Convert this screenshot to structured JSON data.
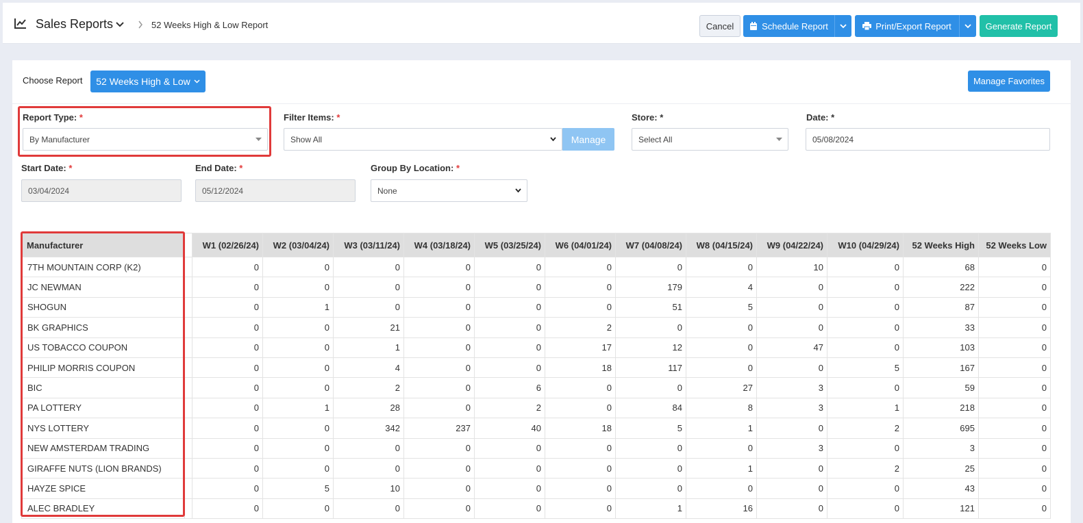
{
  "header": {
    "title": "Sales Reports",
    "current_page": "52 Weeks High & Low Report",
    "cancel_label": "Cancel",
    "schedule_label": "Schedule Report",
    "print_label": "Print/Export Report",
    "generate_label": "Generate Report"
  },
  "toolbar": {
    "choose_label": "Choose Report",
    "choose_value": "52 Weeks High & Low",
    "favorites_label": "Manage Favorites"
  },
  "form": {
    "report_type": {
      "label": "Report Type:",
      "required": "*",
      "value": "By Manufacturer"
    },
    "filter_items": {
      "label": "Filter Items:",
      "required": "*",
      "value": "Show All",
      "manage_label": "Manage"
    },
    "store": {
      "label": "Store:",
      "required": "*",
      "value": "Select All"
    },
    "date": {
      "label": "Date:",
      "required": "*",
      "value": "05/08/2024"
    },
    "start_date": {
      "label": "Start Date:",
      "required": "*",
      "value": "03/04/2024"
    },
    "end_date": {
      "label": "End Date:",
      "required": "*",
      "value": "05/12/2024"
    },
    "group_by": {
      "label": "Group By Location:",
      "required": "*",
      "value": "None"
    }
  },
  "table": {
    "columns": [
      "Manufacturer",
      "W1 (02/26/24)",
      "W2 (03/04/24)",
      "W3 (03/11/24)",
      "W4 (03/18/24)",
      "W5 (03/25/24)",
      "W6 (04/01/24)",
      "W7 (04/08/24)",
      "W8 (04/15/24)",
      "W9 (04/22/24)",
      "W10 (04/29/24)",
      "52 Weeks High",
      "52 Weeks Low"
    ],
    "rows": [
      [
        "7TH MOUNTAIN CORP (K2)",
        "0",
        "0",
        "0",
        "0",
        "0",
        "0",
        "0",
        "0",
        "10",
        "0",
        "68",
        "0"
      ],
      [
        "JC NEWMAN",
        "0",
        "0",
        "0",
        "0",
        "0",
        "0",
        "179",
        "4",
        "0",
        "0",
        "222",
        "0"
      ],
      [
        "SHOGUN",
        "0",
        "1",
        "0",
        "0",
        "0",
        "0",
        "51",
        "5",
        "0",
        "0",
        "87",
        "0"
      ],
      [
        "BK GRAPHICS",
        "0",
        "0",
        "21",
        "0",
        "0",
        "2",
        "0",
        "0",
        "0",
        "0",
        "33",
        "0"
      ],
      [
        "US TOBACCO COUPON",
        "0",
        "0",
        "1",
        "0",
        "0",
        "17",
        "12",
        "0",
        "47",
        "0",
        "103",
        "0"
      ],
      [
        "PHILIP MORRIS COUPON",
        "0",
        "0",
        "4",
        "0",
        "0",
        "18",
        "117",
        "0",
        "0",
        "5",
        "167",
        "0"
      ],
      [
        "BIC",
        "0",
        "0",
        "2",
        "0",
        "6",
        "0",
        "0",
        "27",
        "3",
        "0",
        "59",
        "0"
      ],
      [
        "PA LOTTERY",
        "0",
        "1",
        "28",
        "0",
        "2",
        "0",
        "84",
        "8",
        "3",
        "1",
        "218",
        "0"
      ],
      [
        "NYS LOTTERY",
        "0",
        "0",
        "342",
        "237",
        "40",
        "18",
        "5",
        "1",
        "0",
        "2",
        "695",
        "0"
      ],
      [
        "NEW AMSTERDAM TRADING",
        "0",
        "0",
        "0",
        "0",
        "0",
        "0",
        "0",
        "0",
        "3",
        "0",
        "3",
        "0"
      ],
      [
        "GIRAFFE NUTS (LION BRANDS)",
        "0",
        "0",
        "0",
        "0",
        "0",
        "0",
        "0",
        "1",
        "0",
        "2",
        "25",
        "0"
      ],
      [
        "HAYZE SPICE",
        "0",
        "5",
        "10",
        "0",
        "0",
        "0",
        "0",
        "0",
        "0",
        "0",
        "43",
        "0"
      ],
      [
        "ALEC BRADLEY",
        "0",
        "0",
        "0",
        "0",
        "0",
        "0",
        "1",
        "16",
        "0",
        "0",
        "121",
        "0"
      ]
    ]
  },
  "colors": {
    "primary": "#2f8fe6",
    "generate": "#21c0a8",
    "highlight": "#e03a3a",
    "required": "#e23b3b"
  }
}
